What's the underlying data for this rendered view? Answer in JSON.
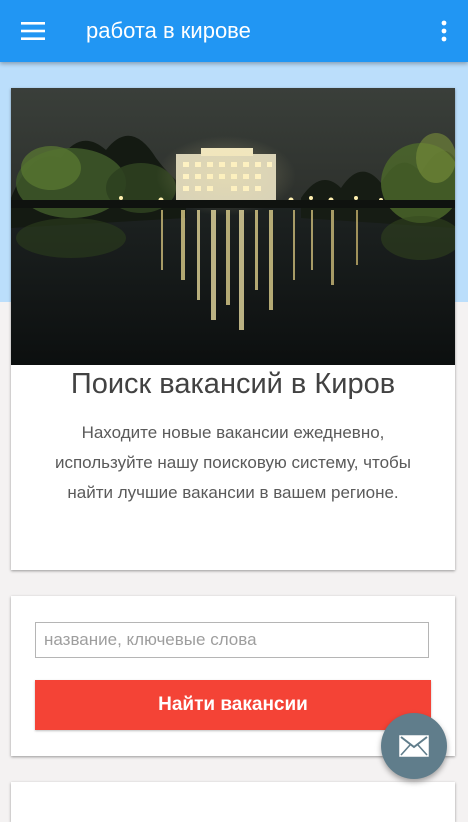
{
  "app_bar": {
    "title": "работа в кирове",
    "background_color": "#2196f3",
    "menu_icon": "hamburger-menu-icon",
    "overflow_icon": "more-vertical-icon"
  },
  "hero": {
    "image_description_icon": "night-city-lake-photo",
    "title": "Поиск вакансий в Киров",
    "text": "Находите новые вакансии ежедневно, используйте нашу поисковую систему, чтобы найти лучшие вакансии в вашем регионе."
  },
  "search": {
    "placeholder": "название, ключевые слова",
    "value": "",
    "button_label": "Найти вакансии",
    "button_color": "#f44336"
  },
  "fab": {
    "icon": "envelope-icon",
    "color": "#607d8b"
  }
}
